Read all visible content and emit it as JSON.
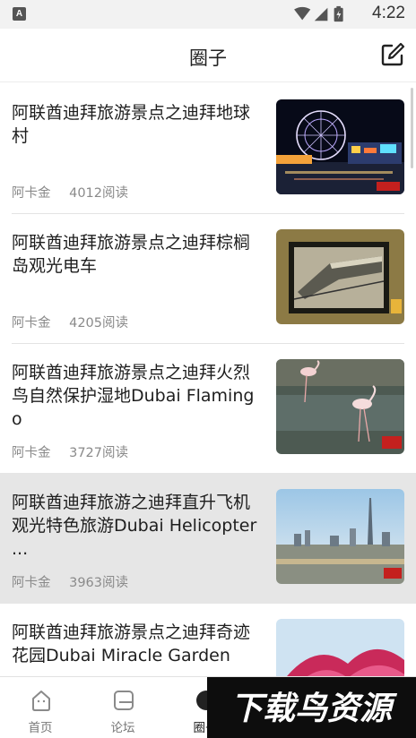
{
  "status_bar": {
    "badge": "A",
    "time": "4:22"
  },
  "header": {
    "title": "圈子"
  },
  "feed": {
    "items": [
      {
        "title": "阿联酋迪拜旅游景点之迪拜地球村",
        "author": "阿卡金",
        "reads": "4012阅读",
        "thumb": "night-ferris-wheel"
      },
      {
        "title": "阿联酋迪拜旅游景点之迪拜棕榈岛观光电车",
        "author": "阿卡金",
        "reads": "4205阅读",
        "thumb": "monorail-painting"
      },
      {
        "title": "阿联酋迪拜旅游景点之迪拜火烈鸟自然保护湿地Dubai Flamingo",
        "author": "阿卡金",
        "reads": "3727阅读",
        "thumb": "flamingos"
      },
      {
        "title": "阿联酋迪拜旅游之迪拜直升飞机观光特色旅游Dubai Helicopter ...",
        "author": "阿卡金",
        "reads": "3963阅读",
        "thumb": "city-skyline"
      },
      {
        "title": "阿联酋迪拜旅游景点之迪拜奇迹花园Dubai Miracle Garden",
        "author": "",
        "reads": "",
        "thumb": "flower-garden"
      }
    ]
  },
  "bottom_nav": {
    "items": [
      {
        "label": "首页",
        "icon": "home-icon"
      },
      {
        "label": "论坛",
        "icon": "forum-icon"
      },
      {
        "label": "圈子",
        "icon": "circle-icon"
      }
    ]
  },
  "watermark": {
    "text": "下载鸟资源"
  },
  "colors": {
    "selected_row": "#e6e6e6",
    "text_primary": "#1e1e1e",
    "text_meta": "#8a8a8a"
  }
}
